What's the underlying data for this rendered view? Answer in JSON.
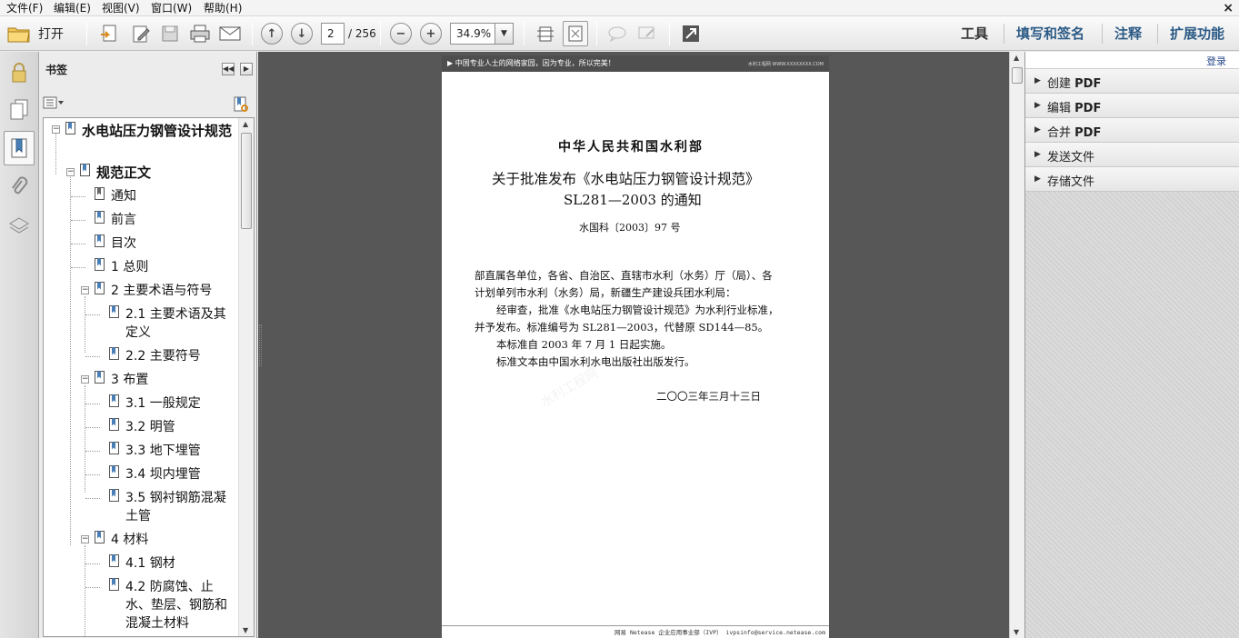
{
  "menu": {
    "items": [
      "文件(F)",
      "编辑(E)",
      "视图(V)",
      "窗口(W)",
      "帮助(H)"
    ],
    "close": "×"
  },
  "toolbar": {
    "open_label": "打开",
    "current_page": "2",
    "total_pages": "/ 256",
    "zoom": "34.9%",
    "right_tools": [
      "工具",
      "填写和签名",
      "注释",
      "扩展功能"
    ]
  },
  "bookmarks": {
    "title": "书签",
    "items": [
      {
        "label": "水电站压力钢管设计规范",
        "line2": "",
        "bold": true
      },
      {
        "label": "规范正文",
        "bold": true
      },
      {
        "label": "通知"
      },
      {
        "label": "前言"
      },
      {
        "label": "目次"
      },
      {
        "label": "1 总则"
      },
      {
        "label": "2 主要术语与符号"
      },
      {
        "label": "2.1 主要术语及其定义"
      },
      {
        "label": "2.2 主要符号"
      },
      {
        "label": "3 布置"
      },
      {
        "label": "3.1 一般规定"
      },
      {
        "label": "3.2 明管"
      },
      {
        "label": "3.3 地下埋管"
      },
      {
        "label": "3.4 坝内埋管"
      },
      {
        "label": "3.5 钢衬钢筋混凝土管"
      },
      {
        "label": "4 材料"
      },
      {
        "label": "4.1 钢材"
      },
      {
        "label": "4.2 防腐蚀、止水、垫层、钢筋和混凝土材料"
      }
    ]
  },
  "document": {
    "header_left": "▶  中国专业人士的网络家园，因为专业，所以完美！",
    "header_right": "水利工程网 WWW.XXXXXXXX.COM",
    "org": "中华人民共和国水利部",
    "title_line1": "关于批准发布《水电站压力钢管设计规范》",
    "title_line2": "SL281—2003 的通知",
    "doc_no": "水国科〔2003〕97 号",
    "p1a": "部直属各单位，各省、自治区、直辖市水利（水务）厅（局）、各",
    "p1b": "计划单列市水利（水务）局，新疆生产建设兵团水利局：",
    "p2a": "经审查，批准《水电站压力钢管设计规范》为水利行业标准，",
    "p2b": "并予发布。标准编号为 SL281—2003，代替原 SD144—85。",
    "p3": "本标准自 2003 年 7 月 1 日起实施。",
    "p4": "标准文本由中国水利水电出版社出版发行。",
    "date": "二〇〇三年三月十三日",
    "footer": "网易  Netease  企业应用事业部（IVP）  ivpsinfo@service.netease.com",
    "watermark": "水利工程网"
  },
  "rightpane": {
    "login": "登录",
    "items": [
      {
        "prefix": "创建",
        "suffix": "PDF"
      },
      {
        "prefix": "编辑",
        "suffix": "PDF"
      },
      {
        "prefix": "合并",
        "suffix": "PDF"
      },
      {
        "prefix": "发送文件",
        "suffix": ""
      },
      {
        "prefix": "存储文件",
        "suffix": ""
      }
    ]
  }
}
